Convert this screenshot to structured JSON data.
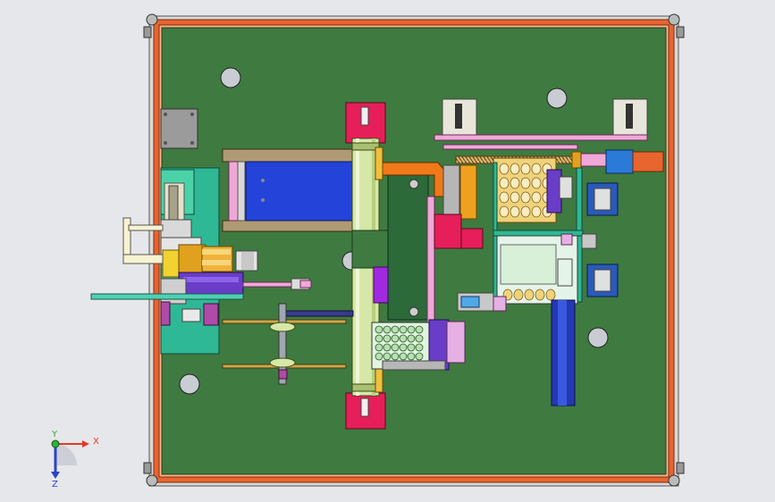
{
  "viewport": {
    "background": "#e6e7ea",
    "plate_color": "#3f7a40",
    "frame_color": "#e0562a"
  },
  "axes": {
    "x_label": "X",
    "y_label": "Y",
    "z_label": "Z",
    "x_color": "#e03a2a",
    "y_color": "#2fb23a",
    "z_color": "#2a43c8"
  }
}
